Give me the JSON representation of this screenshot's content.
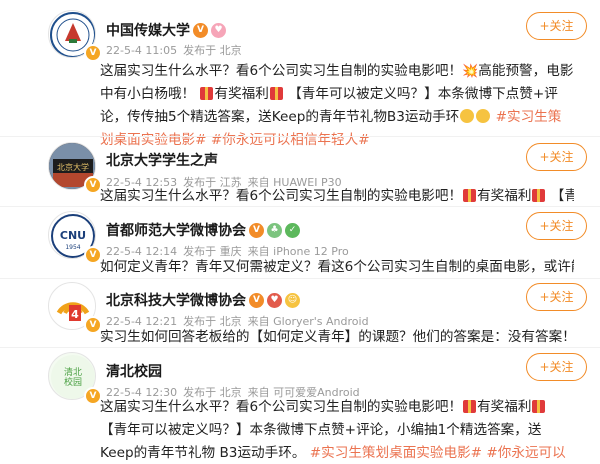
{
  "posts": [
    {
      "name": "中国传媒大学",
      "meta": {
        "time": "22-5-4 11:05",
        "location": "发布于 北京",
        "source": ""
      },
      "follow": "+关注",
      "lines": [
        "这届实习生什么水平？看6个公司实习生自制的实验电影吧！",
        "高能预警，电影中有小白杨哦！",
        "有奖福利",
        "【青年可以被定义吗？】本条微博下点赞+评论，传传抽5个精选答案，送Keep的青年节礼物B3运动手环",
        "#实习生策划桌面实验电影#",
        "#你永远可以相信年轻人#"
      ]
    },
    {
      "name": "北京大学学生之声",
      "meta": {
        "time": "22-5-4 12:53",
        "location": "发布于 江苏",
        "source": "来自 HUAWEI P30"
      },
      "follow": "+关注",
      "lines": [
        "这届实习生什么水平？看6个公司实习生自制的实验电影吧！",
        "有奖福利",
        "【青年可以"
      ]
    },
    {
      "name": "首都师范大学微博协会",
      "meta": {
        "time": "22-5-4 12:14",
        "location": "发布于 重庆",
        "source": "来自 iPhone 12 Pro"
      },
      "follow": "+关注",
      "lines": [
        "如何定义青年？青年又何需被定义？看这6个公司实习生自制的桌面电影，或许能得到"
      ]
    },
    {
      "name": "北京科技大学微博协会",
      "meta": {
        "time": "22-5-4 12:21",
        "location": "发布于 北京",
        "source": "来自 Gloryer's Android"
      },
      "follow": "+关注",
      "lines": [
        "实习生如何回答老板给的【如何定义青年】的课题？他们的答案是：没有答案！（并反"
      ]
    },
    {
      "name": "清北校园",
      "meta": {
        "time": "22-5-4 12:30",
        "location": "发布于 北京",
        "source": "来自 可可爱爱Android"
      },
      "follow": "+关注",
      "lines": [
        "这届实习生什么水平？看6个公司实习生自制的实验电影吧！",
        "有奖福利",
        "【青年可以被定义吗？】本条微博下点赞+评论，小编抽1个精选答案，送Keep的青年节礼物 B3运动手环。",
        "#实习生策划桌面实验电影#",
        "#你永远可以相信年轻人#"
      ]
    }
  ],
  "avatars": {
    "post1": "清北校园"
  },
  "colors": {
    "accent": "#f28c28",
    "tag": "#eb7350",
    "meta": "#9a9a9a"
  }
}
